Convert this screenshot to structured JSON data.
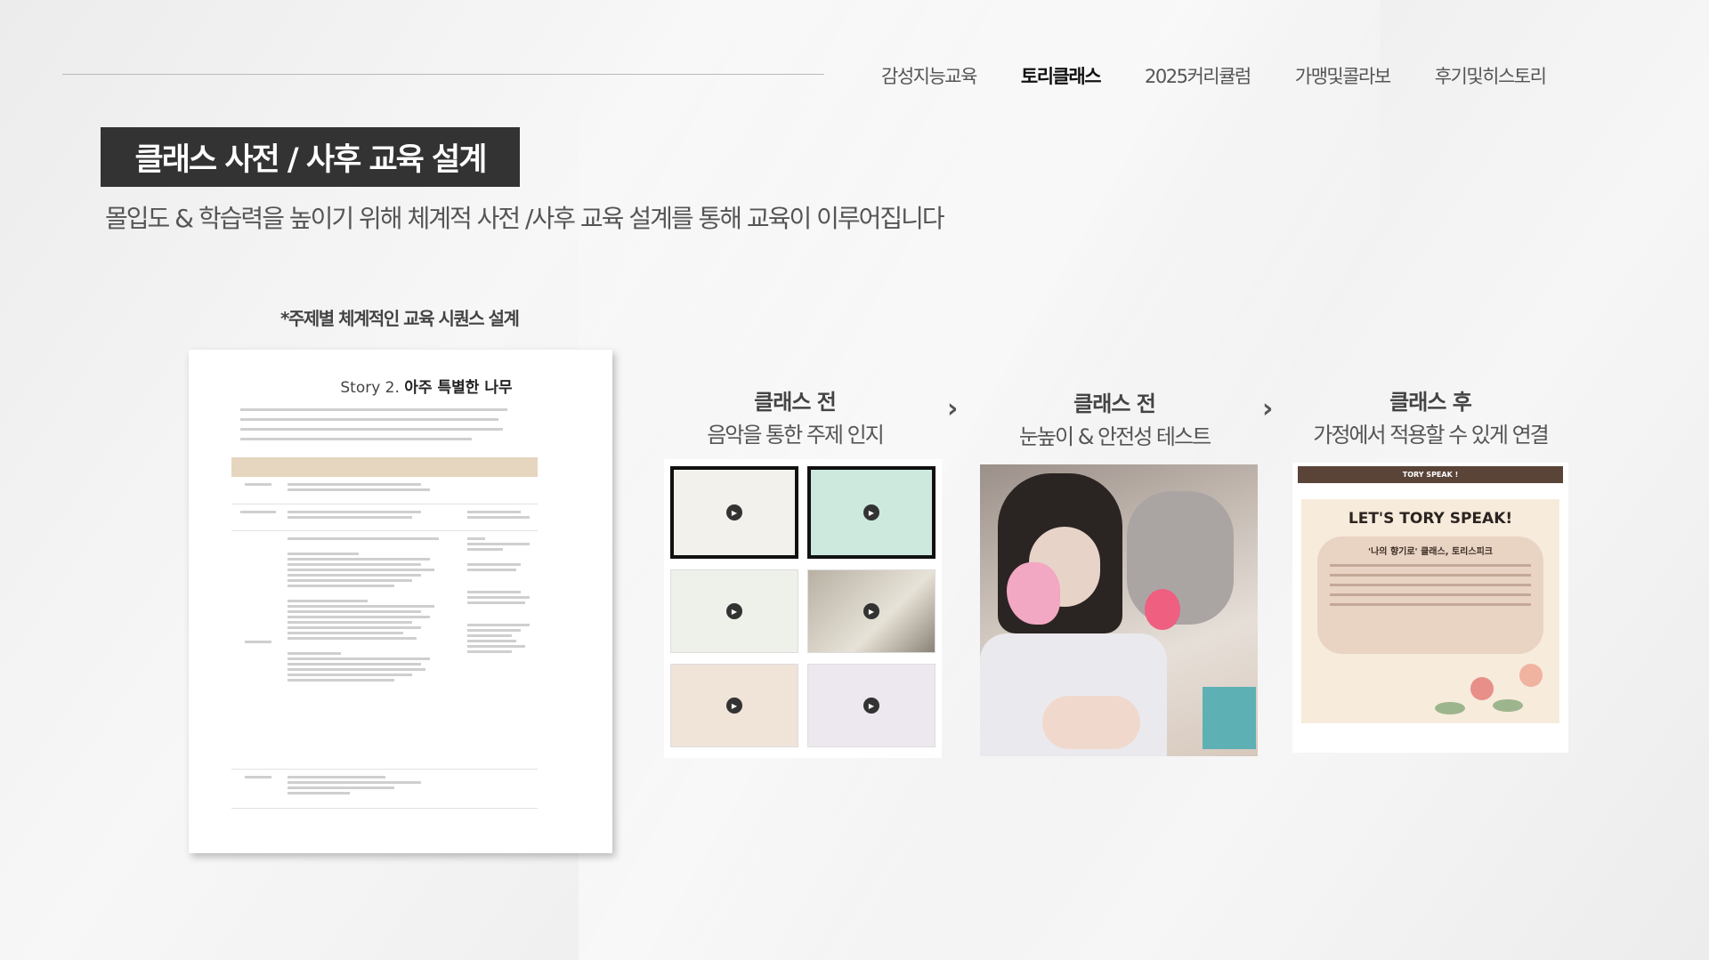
{
  "nav": {
    "items": [
      {
        "label": "감성지능교육",
        "active": false
      },
      {
        "label": "토리클래스",
        "active": true
      },
      {
        "label": "2025커리큘럼",
        "active": false
      },
      {
        "label": "가맹및콜라보",
        "active": false
      },
      {
        "label": "후기및히스토리",
        "active": false
      }
    ]
  },
  "header": {
    "title": "클래스 사전 / 사후 교육 설계",
    "subtitle": "몰입도 & 학습력을 높이기 위해 체계적 사전 /사후 교육 설계를 통해 교육이 이루어집니다"
  },
  "document": {
    "caption": "*주제별 체계적인 교육 시퀀스 설계",
    "story_prefix": "Story 2.",
    "story_title": "아주 특별한 나무"
  },
  "steps": [
    {
      "heading": "클래스 전",
      "description": "음악을 통한 주제 인지"
    },
    {
      "heading": "클래스 전",
      "description": "눈높이 & 안전성 테스트"
    },
    {
      "heading": "클래스 후",
      "description": "가정에서 적용할 수 있게 연결"
    }
  ],
  "poster": {
    "band": "TORY SPEAK !",
    "headline": "LET'S TORY SPEAK!",
    "bubble_title": "'나의 향기로' 클래스, 토리스피크"
  },
  "icons": {
    "arrow": "chevron-right-icon",
    "play": "play-icon"
  }
}
